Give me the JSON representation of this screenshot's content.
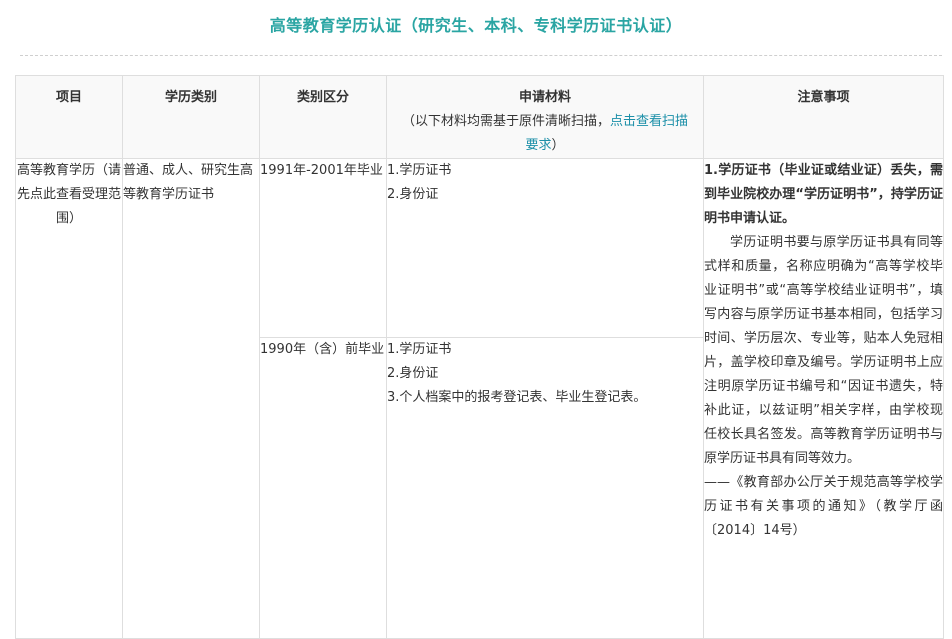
{
  "page": {
    "title": "高等教育学历认证（研究生、本科、专科学历证书认证）"
  },
  "table": {
    "headers": {
      "item": "项目",
      "category": "学历类别",
      "division": "类别区分",
      "materials": "申请材料",
      "materials_note_prefix": "（以下材料均需基于原件清晰扫描，",
      "materials_note_link": "点击查看扫描要求",
      "materials_note_suffix": "）",
      "notes": "注意事项"
    },
    "item": "高等教育学历（请先点此查看受理范围）",
    "category": "普通、成人、研究生高等教育学历证书",
    "rows": [
      {
        "division": "1991年-2001年毕业",
        "materials": [
          "1.学历证书",
          "2.身份证"
        ]
      },
      {
        "division": "1990年（含）前毕业",
        "materials": [
          "1.学历证书",
          "2.身份证",
          "3.个人档案中的报考登记表、毕业生登记表。"
        ]
      }
    ],
    "notice": {
      "strong": "1.学历证书（毕业证或结业证）丢失，需到毕业院校办理“学历证明书”，持学历证明书申请认证。",
      "body": "学历证明书要与原学历证书具有同等式样和质量，名称应明确为“高等学校毕业证明书”或“高等学校结业证明书”，填写内容与原学历证书基本相同，包括学习时间、学历层次、专业等，贴本人免冠相片，盖学校印章及编号。学历证明书上应注明原学历证书编号和“因证书遗失，特补此证，以兹证明”相关字样，由学校现任校长具名签发。高等教育学历证明书与原学历证书具有同等效力。",
      "source": "——《教育部办公厅关于规范高等学校学历证书有关事项的通知》（教学厅函〔2014〕14号）"
    }
  }
}
